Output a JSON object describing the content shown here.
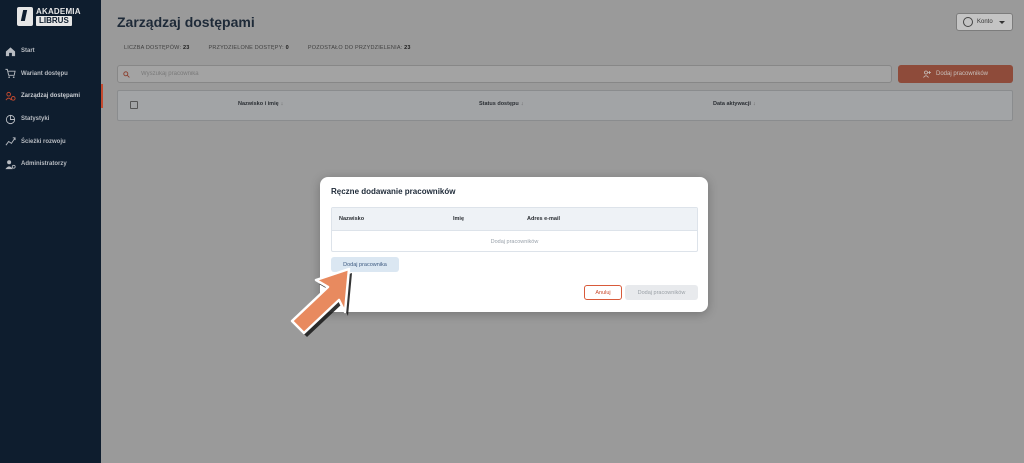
{
  "sidebar": {
    "logo": {
      "line1": "AKADEMIA",
      "line2": "LIBRUS"
    },
    "items": [
      {
        "label": "Start",
        "icon": "home-icon"
      },
      {
        "label": "Wariant dostępu",
        "icon": "cart-icon"
      },
      {
        "label": "Zarządzaj dostępami",
        "icon": "users-manage-icon",
        "active": true
      },
      {
        "label": "Statystyki",
        "icon": "chart-icon"
      },
      {
        "label": "Ścieżki rozwoju",
        "icon": "path-icon"
      },
      {
        "label": "Administratorzy",
        "icon": "admin-icon"
      }
    ]
  },
  "header": {
    "title": "Zarządzaj dostępami",
    "account_label": "Konto"
  },
  "stats": {
    "total_label": "LICZBA DOSTĘPÓW:",
    "total_value": "23",
    "assigned_label": "PRZYDZIELONE DOSTĘPY:",
    "assigned_value": "0",
    "remaining_label": "POZOSTAŁO DO PRZYDZIELENIA:",
    "remaining_value": "23"
  },
  "search": {
    "placeholder": "Wyszukaj pracownika"
  },
  "add_button_label": "Dodaj pracowników",
  "table": {
    "columns": [
      "Nazwisko i imię",
      "Status dostępu",
      "Data aktywacji"
    ],
    "sort_glyph": "↓"
  },
  "modal": {
    "title": "Ręczne dodawanie pracowników",
    "columns": [
      "Nazwisko",
      "Imię",
      "Adres e-mail"
    ],
    "empty_text": "Dodaj pracowników",
    "add_employee_label": "Dodaj pracownika",
    "cancel_label": "Anuluj",
    "submit_label": "Dodaj pracowników"
  },
  "colors": {
    "sidebar_bg": "#0e1d2e",
    "accent": "#d85a3a",
    "arrow": "#e88a5f"
  }
}
